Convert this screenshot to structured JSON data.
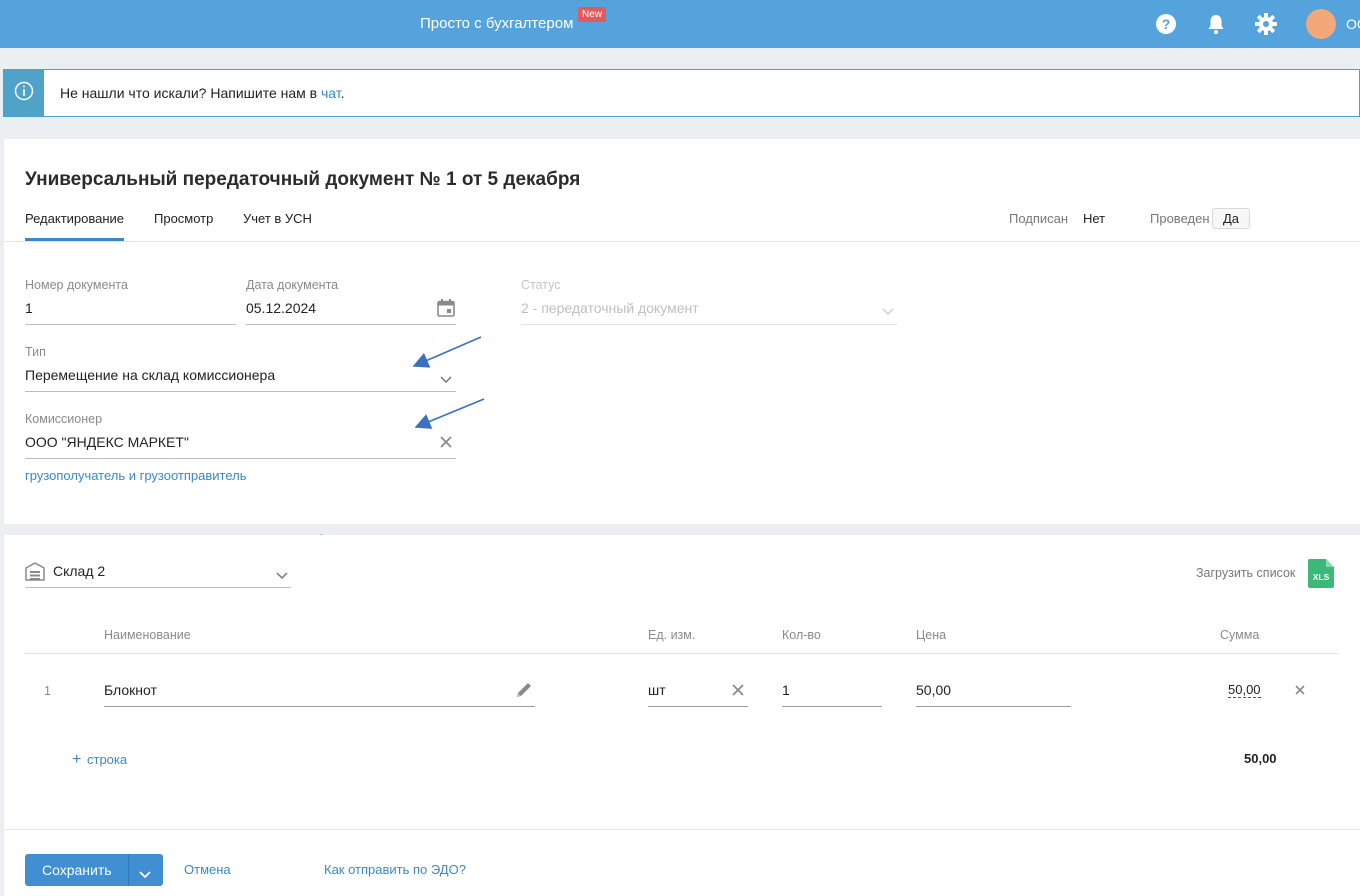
{
  "header": {
    "brand": "Просто с бухгалтером",
    "badge": "New",
    "icons": [
      "help-icon",
      "bell-icon",
      "gear-icon"
    ],
    "avatar_text": "ОС",
    "color": "#55a3dc"
  },
  "banner": {
    "text": "Не нашли что искали? Напишите нам в ",
    "link": "чат",
    "after": "."
  },
  "document": {
    "title": "Универсальный передаточный документ № 1 от 5 декабря",
    "tabs": [
      {
        "label": "Редактирование",
        "active": true
      },
      {
        "label": "Просмотр",
        "active": false
      },
      {
        "label": "Учет в УСН",
        "active": false
      }
    ],
    "signed_label": "Подписан",
    "signed_value": "Нет",
    "posted_label": "Проведен",
    "posted_value": "Да"
  },
  "form": {
    "doc_number_label": "Номер документа",
    "doc_number": "1",
    "doc_date_label": "Дата документа",
    "doc_date": "05.12.2024",
    "status_label": "Статус",
    "status_value": "2 - передаточный документ",
    "type_label": "Тип",
    "type_value": "Перемещение на склад комиссионера",
    "commissioner_label": "Комиссионер",
    "commissioner_value": "ООО \"ЯНДЕКС МАРКЕТ\"",
    "consignee_link": "грузополучатель и грузоотправитель"
  },
  "items": {
    "warehouse": "Склад 2",
    "upload_label": "Загрузить список",
    "upload_icon_text": "XLS",
    "columns": [
      "Наименование",
      "Ед. изм.",
      "Кол-во",
      "Цена",
      "Сумма"
    ],
    "rows": [
      {
        "index": "1",
        "name": "Блокнот",
        "unit": "шт",
        "qty": "1",
        "price": "50,00",
        "sum": "50,00"
      }
    ],
    "add_row": "строка",
    "total": "50,00"
  },
  "footer": {
    "save": "Сохранить",
    "cancel": "Отмена",
    "edo_link": "Как отправить по ЭДО?"
  }
}
